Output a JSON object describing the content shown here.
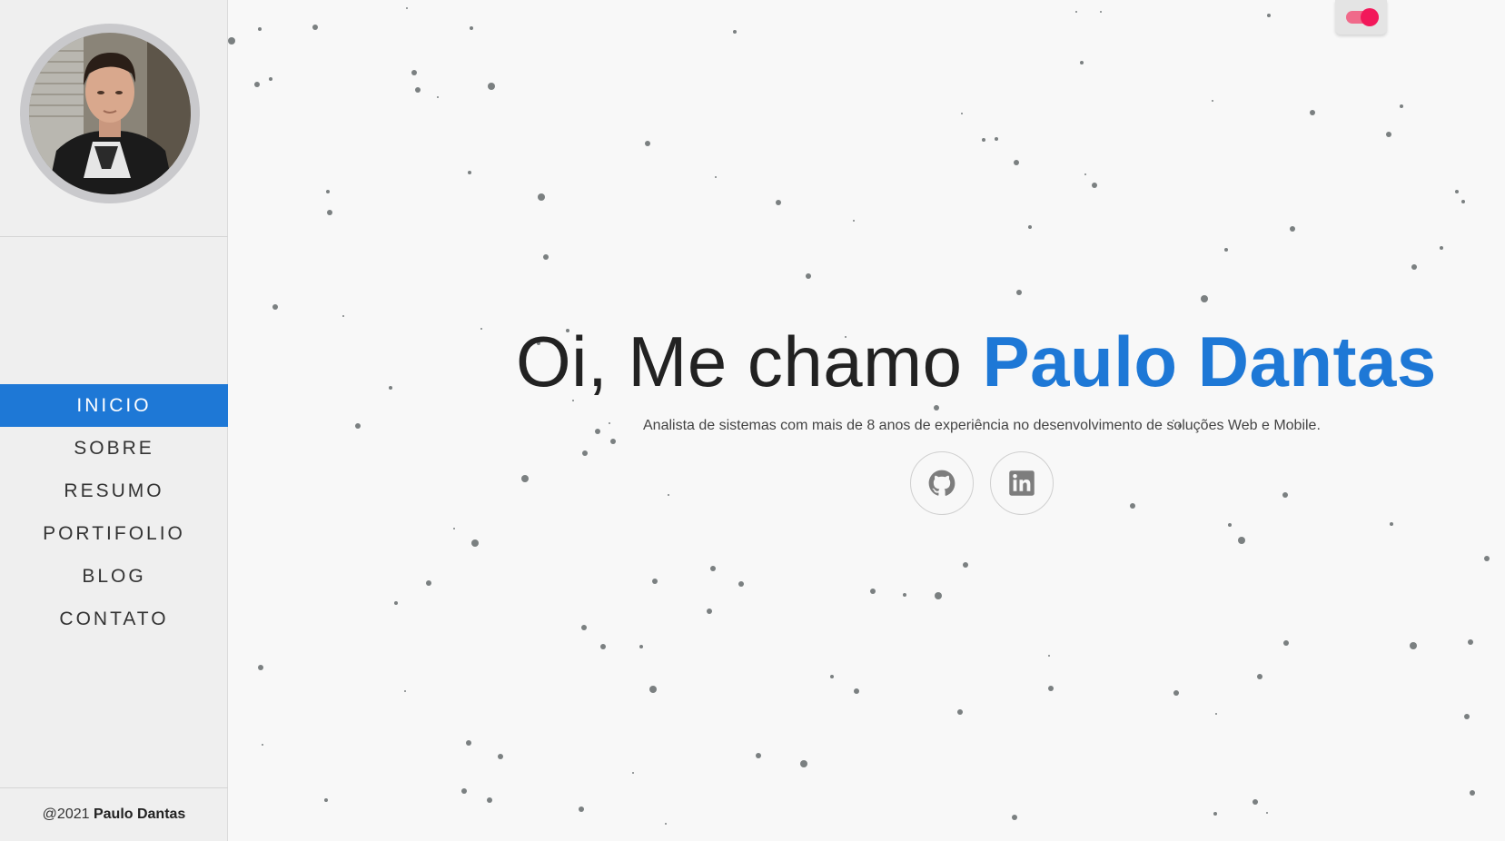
{
  "sidebar": {
    "nav": [
      {
        "label": "INICIO",
        "active": true
      },
      {
        "label": "SOBRE",
        "active": false
      },
      {
        "label": "RESUMO",
        "active": false
      },
      {
        "label": "PORTIFOLIO",
        "active": false
      },
      {
        "label": "BLOG",
        "active": false
      },
      {
        "label": "CONTATO",
        "active": false
      }
    ],
    "footer": {
      "prefix": "@2021",
      "name": "Paulo Dantas"
    }
  },
  "hero": {
    "greeting": "Oi, Me chamo",
    "name": "Paulo Dantas",
    "subtitle": "Analista de sistemas com mais de 8 anos de experiência no desenvolvimento de soluções Web e Mobile."
  },
  "social": [
    {
      "name": "github",
      "icon": "github-icon"
    },
    {
      "name": "linkedin",
      "icon": "linkedin-icon"
    }
  ],
  "theme_toggle": {
    "on": true
  },
  "colors": {
    "accent": "#1e78d6",
    "toggle": "#f2185a",
    "particle": "#7b8081",
    "background": "#f8f8f8",
    "sidebar": "#efefef"
  }
}
